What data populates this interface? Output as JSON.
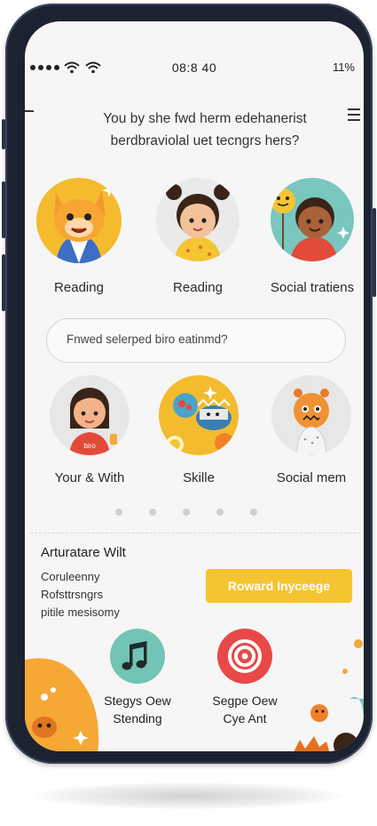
{
  "status_bar": {
    "time": "08:8 40",
    "battery": "11%"
  },
  "header": {
    "line1": "You by she fwd herm edehanerist",
    "line2": "berdbraviolal uet tecngrs hers?"
  },
  "top_cards": [
    {
      "label": "Reading"
    },
    {
      "label": "Reading"
    },
    {
      "label": "Social tratiens"
    }
  ],
  "search": {
    "placeholder": "Fnwed selerped biro eatinmd?"
  },
  "middle_cards": [
    {
      "label": "Your & With",
      "shirt_text": "biro"
    },
    {
      "label": "Skille"
    },
    {
      "label": "Social mem"
    }
  ],
  "pagination": {
    "count": 5
  },
  "rewards": {
    "title": "Arturatare Wilt",
    "lines": [
      "Coruleenny",
      "Rofsttrsngrs",
      "pitile mesisomy"
    ],
    "button_label": "Roward Inyceege"
  },
  "bottom_items": [
    {
      "line1": "Stegys Oew",
      "line2": "Stending",
      "icon": "music-note-icon"
    },
    {
      "line1": "Segpe Oew",
      "line2": "Cye Ant",
      "icon": "target-icon"
    }
  ],
  "colors": {
    "accent_yellow": "#f6c431",
    "teal": "#72c4b6",
    "red": "#e94848",
    "orange": "#f7a632"
  }
}
